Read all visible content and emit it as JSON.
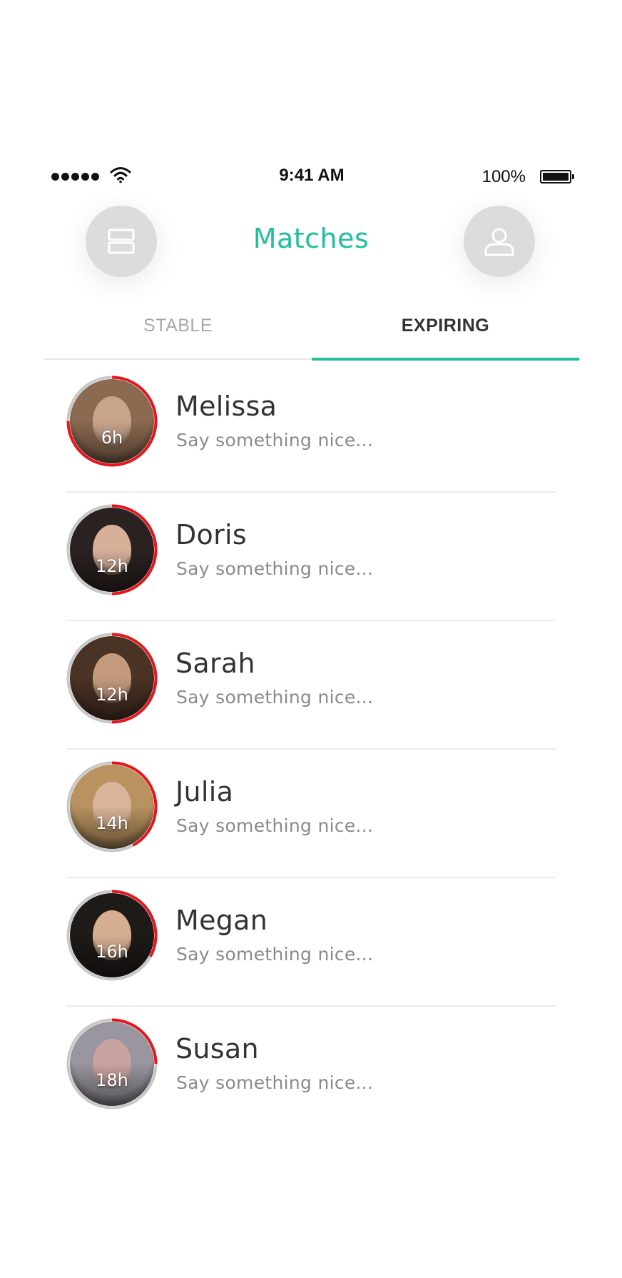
{
  "status_bar": {
    "time": "9:41 AM",
    "battery_percent": "100%",
    "signal_bars": 5
  },
  "header": {
    "title": "Matches",
    "left_button_icon": "stack-icon",
    "right_button_icon": "profile-icon"
  },
  "tabs": [
    {
      "label": "STABLE",
      "active": false
    },
    {
      "label": "EXPIRING",
      "active": true
    }
  ],
  "colors": {
    "accent": "#1fbf9f",
    "timer_ring": "#e8141c",
    "ring_track": "#c8c8c8"
  },
  "matches": [
    {
      "name": "Melissa",
      "preview": "Say something nice...",
      "timer": "6h",
      "time_left_fraction": 0.75,
      "skin": "#c9a48c",
      "hair": "#8a6a50"
    },
    {
      "name": "Doris",
      "preview": "Say something nice...",
      "timer": "12h",
      "time_left_fraction": 0.5,
      "skin": "#d8b09a",
      "hair": "#2a2220"
    },
    {
      "name": "Sarah",
      "preview": "Say something nice...",
      "timer": "12h",
      "time_left_fraction": 0.5,
      "skin": "#c49a7c",
      "hair": "#4a3224"
    },
    {
      "name": "Julia",
      "preview": "Say something nice...",
      "timer": "14h",
      "time_left_fraction": 0.42,
      "skin": "#d9b49a",
      "hair": "#b89260"
    },
    {
      "name": "Megan",
      "preview": "Say something nice...",
      "timer": "16h",
      "time_left_fraction": 0.33,
      "skin": "#d6ae92",
      "hair": "#1e1a18"
    },
    {
      "name": "Susan",
      "preview": "Say something nice...",
      "timer": "18h",
      "time_left_fraction": 0.25,
      "skin": "#c9a3a0",
      "hair": "#9a96a0"
    }
  ]
}
